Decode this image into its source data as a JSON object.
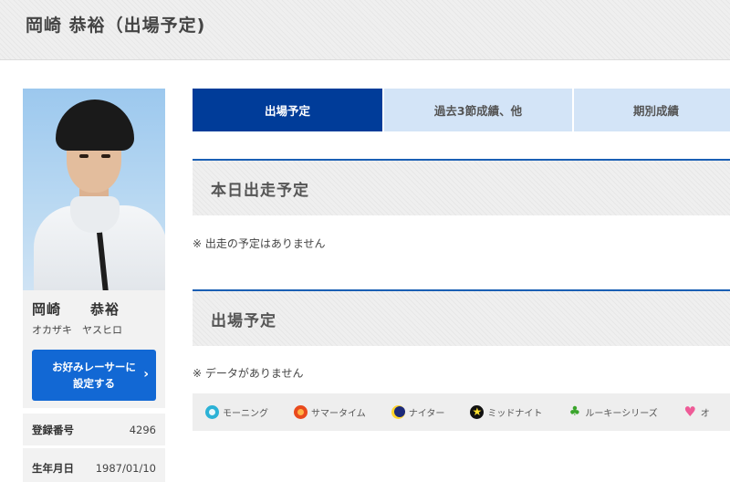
{
  "page": {
    "title": "岡崎 恭裕（出場予定)"
  },
  "profile": {
    "name_kanji": "岡崎　　恭裕",
    "name_kana": "オカザキ　ヤスヒロ",
    "favorite_button_label": "お好みレーサーに\n設定する",
    "info": [
      {
        "label": "登録番号",
        "value": "4296"
      },
      {
        "label": "生年月日",
        "value": "1987/01/10"
      }
    ]
  },
  "tabs": [
    {
      "label": "出場予定",
      "active": true
    },
    {
      "label": "過去3節成績、他",
      "active": false
    },
    {
      "label": "期別成績",
      "active": false
    }
  ],
  "sections": {
    "today": {
      "title": "本日出走予定",
      "note": "※ 出走の予定はありません"
    },
    "schedule": {
      "title": "出場予定",
      "note": "※ データがありません"
    }
  },
  "legend": [
    {
      "label": "モーニング",
      "icon": "morning-icon"
    },
    {
      "label": "サマータイム",
      "icon": "summer-time-icon"
    },
    {
      "label": "ナイター",
      "icon": "nighter-icon"
    },
    {
      "label": "ミッドナイト",
      "icon": "midnight-icon"
    },
    {
      "label": "ルーキーシリーズ",
      "icon": "rookie-series-icon"
    },
    {
      "label": "オ",
      "icon": "heart-icon"
    }
  ],
  "colors": {
    "tab_active": "#003c99",
    "tab_inactive": "#d3e4f7",
    "button": "#1268d4",
    "section_border": "#1a5fb4"
  }
}
